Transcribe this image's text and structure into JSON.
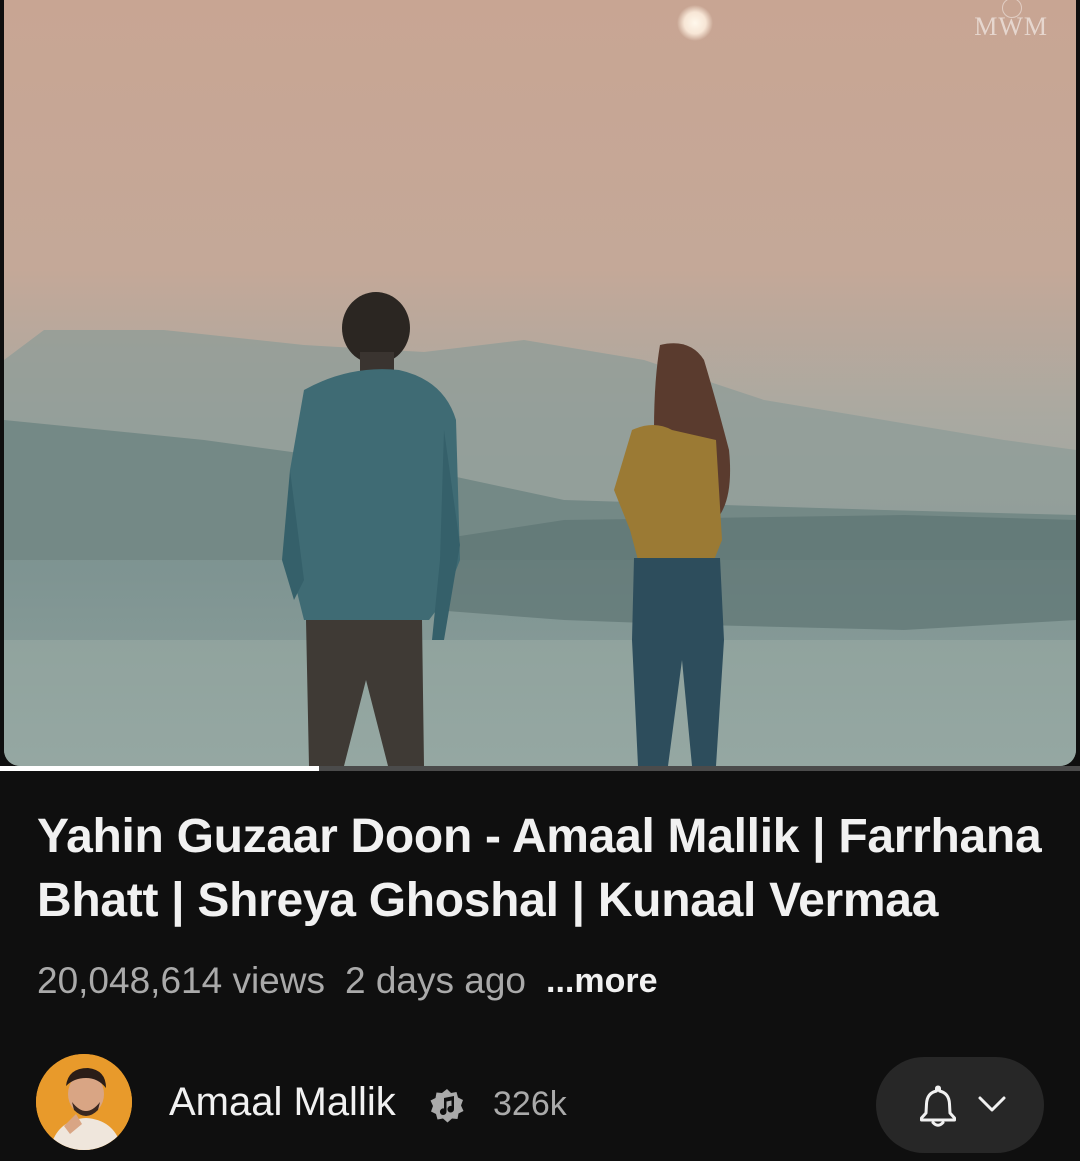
{
  "video": {
    "watermark": "MWM",
    "progress_fraction": 0.295
  },
  "info": {
    "title": "Yahin Guzaar Doon - Amaal Mallik | Farrhana Bhatt | Shreya Ghoshal | Kunaal Vermaa",
    "views": "20,048,614 views",
    "age": "2 days ago",
    "more_label": "...more"
  },
  "channel": {
    "name": "Amaal Mallik",
    "verified_icon": "music-note-verified-icon",
    "subscribers": "326k",
    "notification_icon": "bell-icon",
    "dropdown_icon": "chevron-down-icon"
  },
  "colors": {
    "background": "#0f0f0f",
    "text_primary": "#f1f1f1",
    "text_secondary": "#aaaaaa",
    "pill": "#272727",
    "progress": "#ffffff"
  }
}
